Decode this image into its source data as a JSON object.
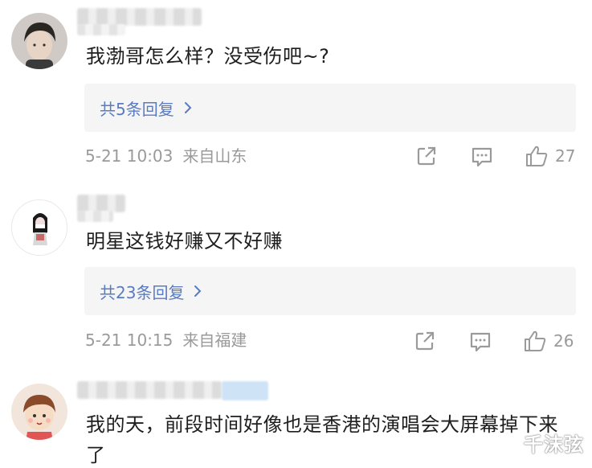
{
  "comments": [
    {
      "text": "我渤哥怎么样？没受伤吧~?",
      "reply_label": "共5条回复",
      "timestamp": "5-21 10:03",
      "location": "来自山东",
      "likes": "27"
    },
    {
      "text": "明星这钱好赚又不好赚",
      "reply_label": "共23条回复",
      "timestamp": "5-21 10:15",
      "location": "来自福建",
      "likes": "26"
    },
    {
      "text": "我的天，前段时间好像也是香港的演唱会大屏幕掉下来了"
    }
  ],
  "watermark": "千沫弦",
  "colors": {
    "reply_link": "#5a7bbf",
    "meta_text": "#9a9a9a",
    "reply_bg": "#f5f5f5"
  },
  "icons": {
    "share": "share-icon",
    "comment": "comment-icon",
    "like": "thumbs-up-icon",
    "chevron": "chevron-right-icon"
  }
}
